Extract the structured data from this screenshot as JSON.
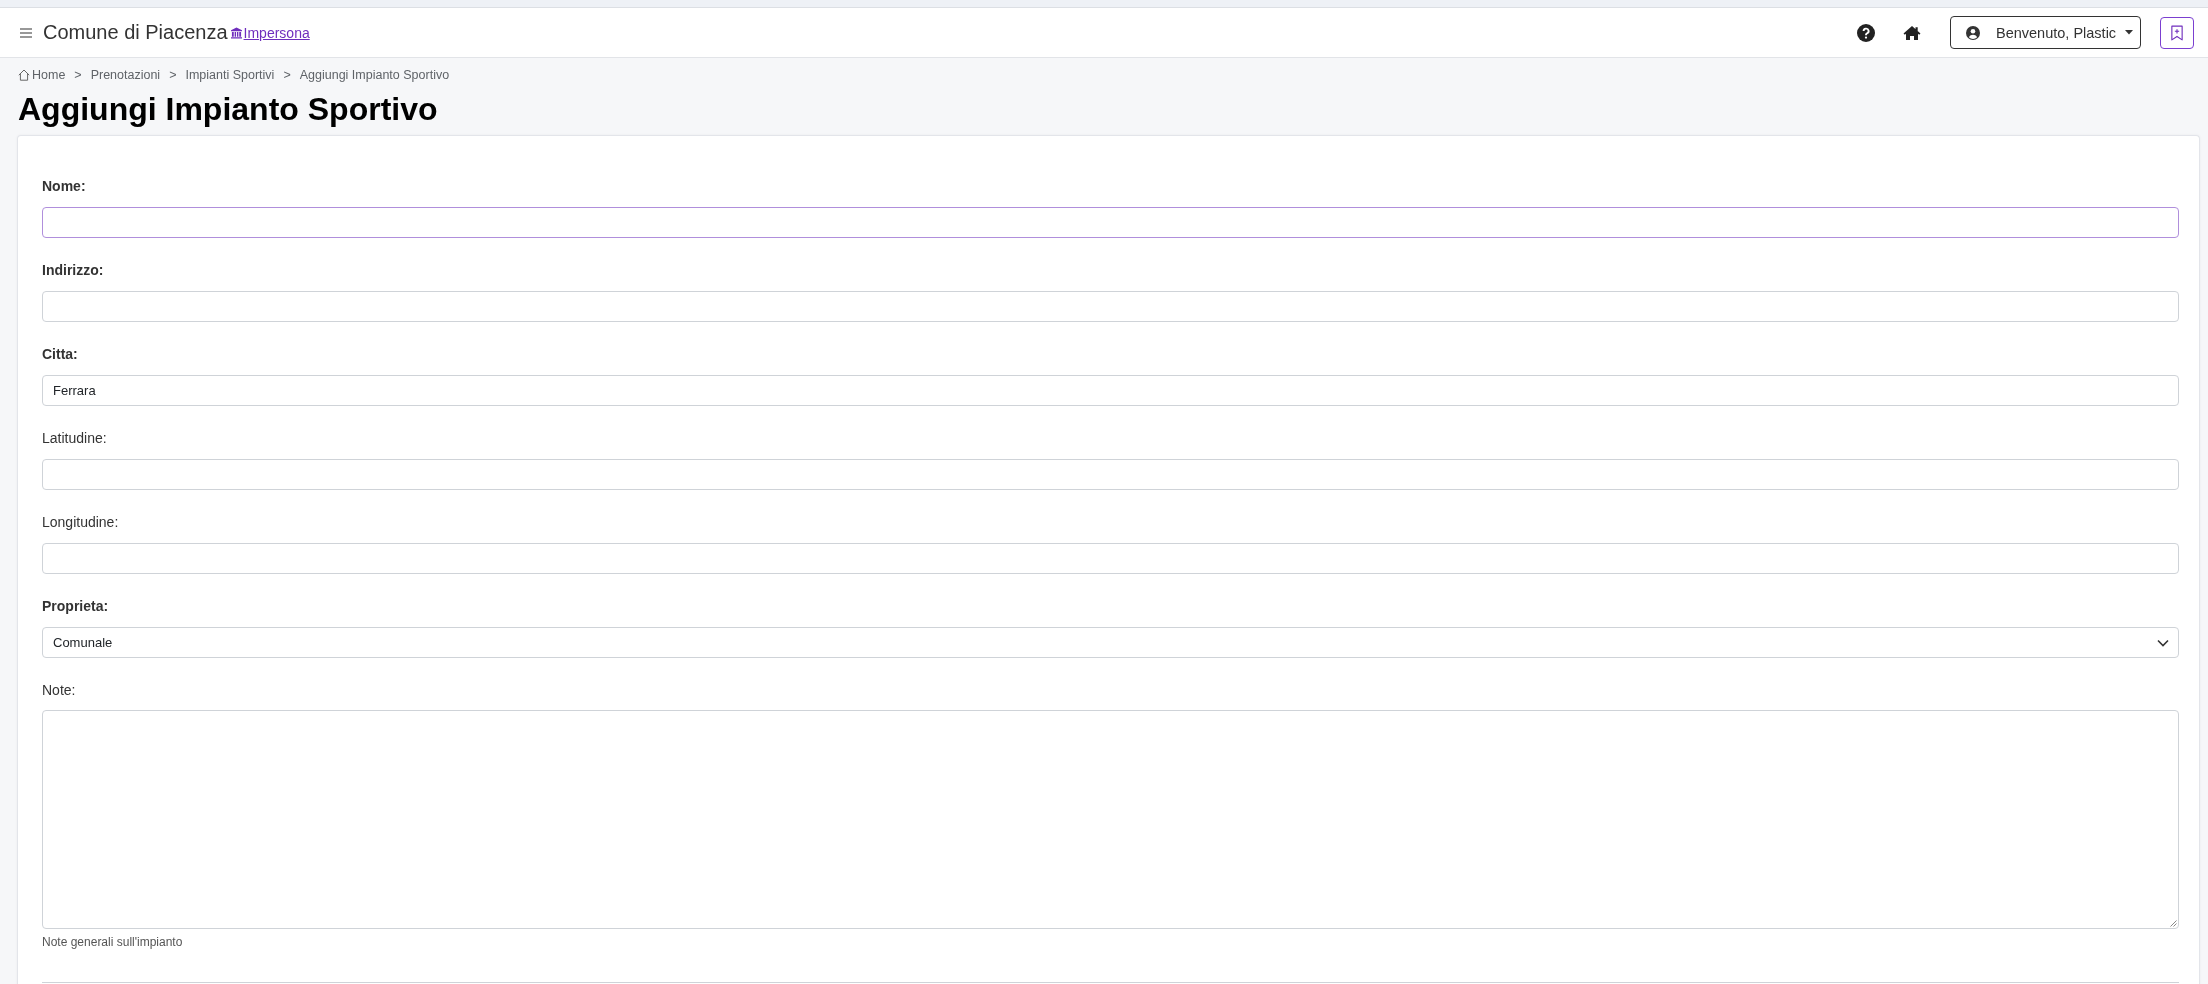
{
  "navbar": {
    "title": "Comune di Piacenza",
    "impersona_link": "Impersona",
    "user_menu": "Benvenuto, Plastic"
  },
  "breadcrumb": [
    {
      "label": "Home",
      "separator": ">"
    },
    {
      "label": "Prenotazioni",
      "separator": ">"
    },
    {
      "label": "Impianti Sportivi",
      "separator": ">"
    },
    {
      "label": "Aggiungi Impianto Sportivo"
    }
  ],
  "page_title": "Aggiungi Impianto Sportivo",
  "form": {
    "fields": [
      {
        "kind": "input",
        "label": "Nome:",
        "required": true,
        "focused": true
      },
      {
        "kind": "input",
        "label": "Indirizzo:",
        "required": true,
        "focused": false
      },
      {
        "kind": "input",
        "label": "Citta:",
        "required": true,
        "focused": false,
        "value": "Ferrara"
      },
      {
        "kind": "input",
        "label": "Latitudine:",
        "required": false,
        "focused": false
      },
      {
        "kind": "input",
        "label": "Longitudine:",
        "required": false,
        "focused": false
      },
      {
        "kind": "select",
        "label": "Proprieta:",
        "required": true,
        "focused": false,
        "value": "Comunale"
      },
      {
        "kind": "textarea",
        "label": "Note:",
        "required": false,
        "focused": false,
        "help": "Note generali sull'impianto"
      }
    ]
  }
}
